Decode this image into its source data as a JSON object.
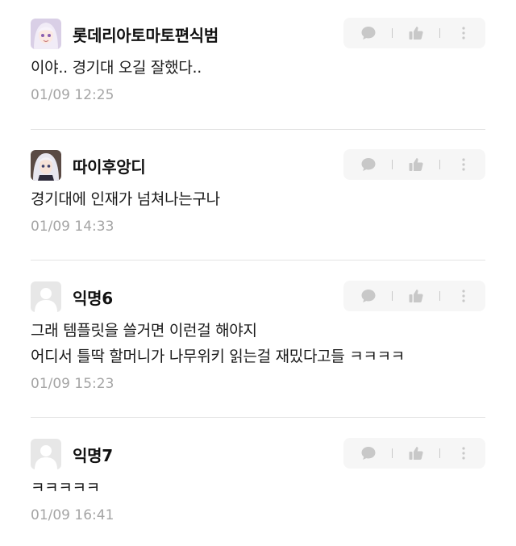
{
  "colors": {
    "accent_bg": "#f6f6f6",
    "icon": "#c8c8c8",
    "timestamp": "#a5a5a5",
    "divider": "#e3e3e3"
  },
  "icons": {
    "reply": "speech-bubble-icon",
    "like": "thumbs-up-icon",
    "more": "more-vertical-icon"
  },
  "comments": [
    {
      "author": "롯데리아토마토편식범",
      "avatar": "anime-avatar-1",
      "lines": [
        "이야.. 경기대 오길 잘했다.."
      ],
      "time": "01/09 12:25"
    },
    {
      "author": "따이후앙디",
      "avatar": "anime-avatar-2",
      "lines": [
        "경기대에 인재가 넘쳐나는구나"
      ],
      "time": "01/09 14:33"
    },
    {
      "author": "익명6",
      "avatar": "default-avatar",
      "lines": [
        "그래 템플릿을 쓸거면 이런걸 해야지",
        "어디서 틀딱 할머니가 나무위키 읽는걸 재밌다고들 ㅋㅋㅋㅋ"
      ],
      "time": "01/09 15:23"
    },
    {
      "author": "익명7",
      "avatar": "default-avatar",
      "lines": [
        "ㅋㅋㅋㅋㅋ"
      ],
      "time": "01/09 16:41"
    }
  ]
}
